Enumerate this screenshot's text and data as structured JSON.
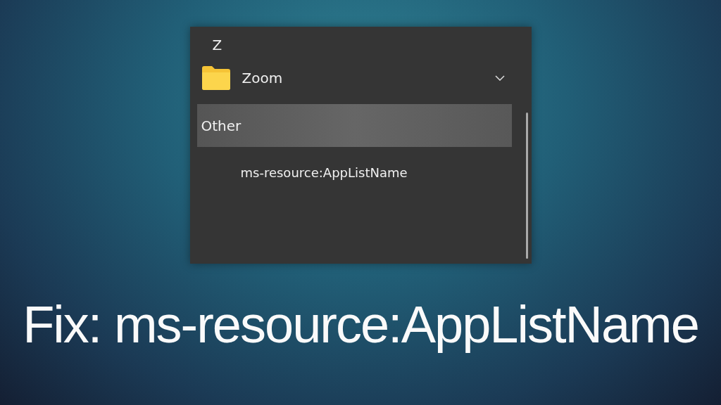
{
  "start_menu": {
    "entries": [
      {
        "kind": "header",
        "label": "Z",
        "selected": false
      },
      {
        "kind": "folder",
        "label": "Zoom",
        "expanded": false
      },
      {
        "kind": "header",
        "label": "Other",
        "selected": true
      },
      {
        "kind": "app",
        "label": "ms-resource:AppListName"
      }
    ]
  },
  "headline": "Fix: ms-resource:AppListName"
}
